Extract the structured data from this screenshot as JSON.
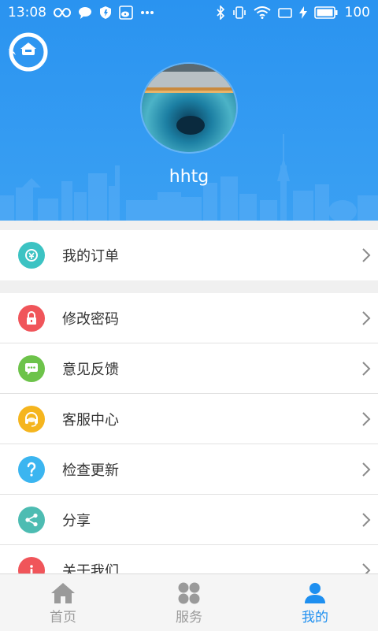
{
  "status": {
    "time": "13:08",
    "battery": "100"
  },
  "profile": {
    "username": "hhtg"
  },
  "menu": {
    "orders": {
      "label": "我的订单",
      "icon": "order-icon",
      "color": "#3cc3c3"
    },
    "password": {
      "label": "修改密码",
      "icon": "lock-icon",
      "color": "#f0555a"
    },
    "feedback": {
      "label": "意见反馈",
      "icon": "chat-bubble-icon",
      "color": "#6dc34a"
    },
    "service": {
      "label": "客服中心",
      "icon": "headset-icon",
      "color": "#f5b51e"
    },
    "update": {
      "label": "检查更新",
      "icon": "question-icon",
      "color": "#3bb5f0"
    },
    "share": {
      "label": "分享",
      "icon": "share-icon",
      "color": "#4dbcb2"
    },
    "about": {
      "label": "关于我们",
      "icon": "info-icon",
      "color": "#f0555a"
    }
  },
  "tabbar": {
    "home": "首页",
    "services": "服务",
    "mine": "我的",
    "active_color": "#1e8ff0",
    "inactive_color": "#9a9a9a"
  }
}
